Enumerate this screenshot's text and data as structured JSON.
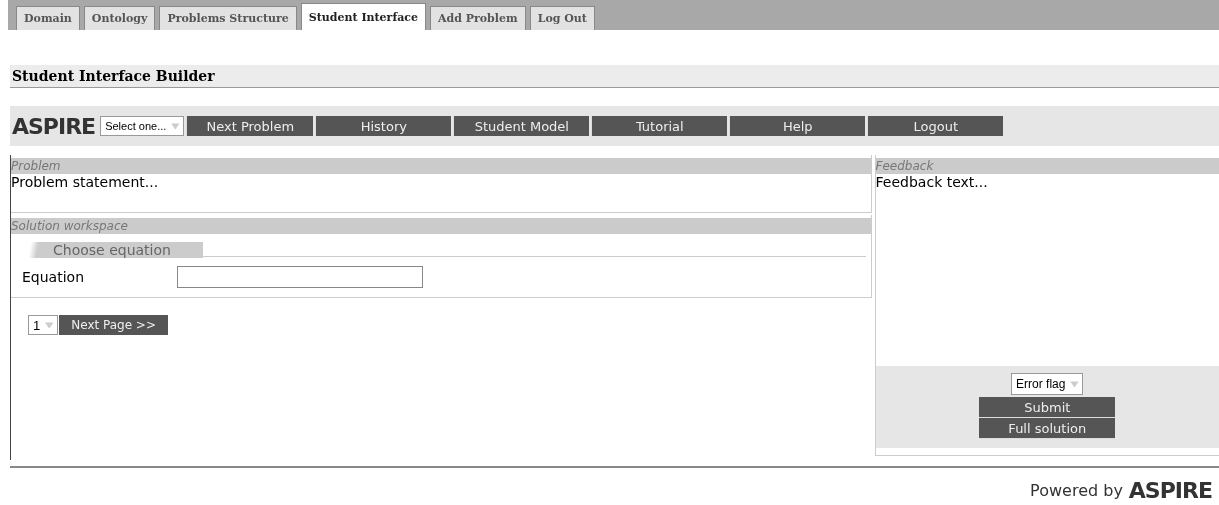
{
  "tabs": [
    {
      "label": "Domain",
      "selected": false
    },
    {
      "label": "Ontology",
      "selected": false
    },
    {
      "label": "Problems Structure",
      "selected": false
    },
    {
      "label": "Student Interface",
      "selected": true
    },
    {
      "label": "Add Problem",
      "selected": false
    },
    {
      "label": "Log Out",
      "selected": false
    }
  ],
  "page_title": "Student Interface Builder",
  "toolbar": {
    "logo": "ASPIRE",
    "problem_select": "Select one...",
    "buttons": [
      "Next Problem",
      "History",
      "Student Model",
      "Tutorial",
      "Help",
      "Logout"
    ]
  },
  "problem": {
    "heading": "Problem",
    "text": "Problem statement..."
  },
  "workspace": {
    "heading": "Solution workspace",
    "tab": "Choose equation",
    "field_label": "Equation",
    "page_select": "1",
    "next_page": "Next Page >>"
  },
  "feedback": {
    "heading": "Feedback",
    "text": "Feedback text...",
    "error_select": "Error flag",
    "buttons": [
      "Submit",
      "Full solution"
    ]
  },
  "footer": {
    "powered_by": "Powered by",
    "logo": "ASPIRE"
  }
}
